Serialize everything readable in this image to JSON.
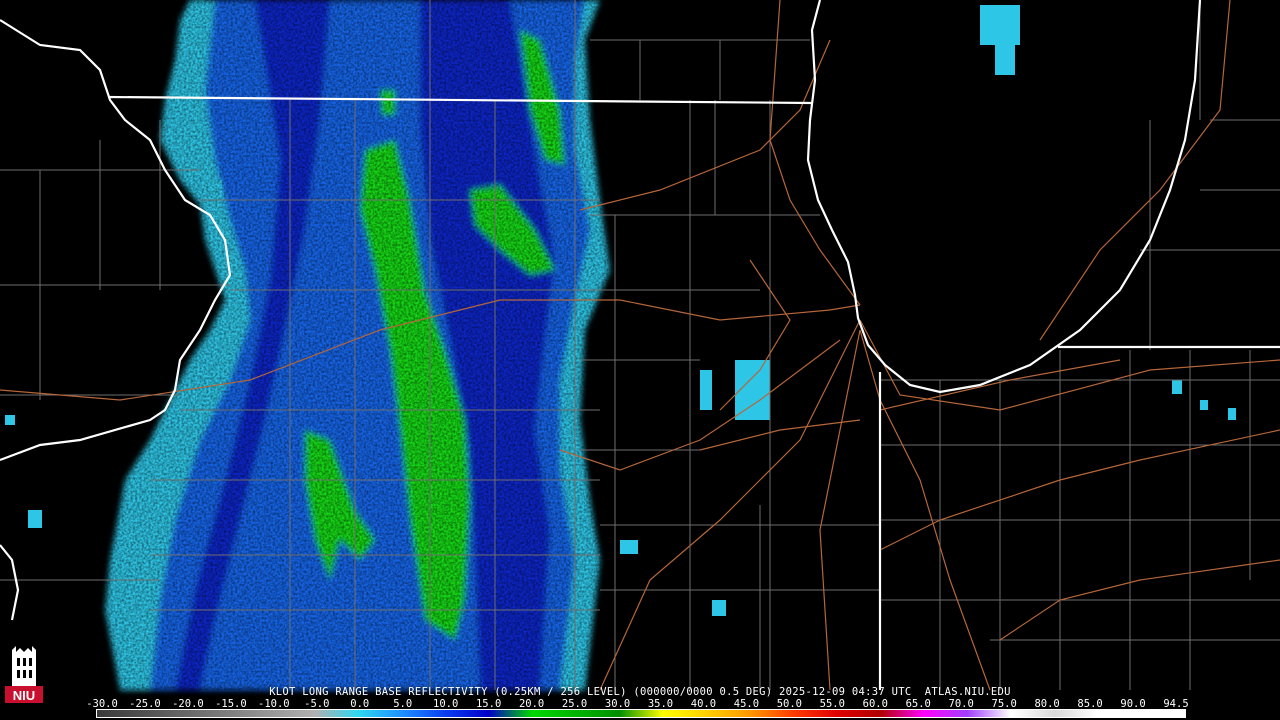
{
  "caption": "KLOT LONG RANGE BASE REFLECTIVITY (0.25KM / 256 LEVEL) (000000/0000 0.5 DEG) 2025-12-09 04:37 UTC  ATLAS.NIU.EDU",
  "scale": {
    "labels": [
      "-30.0",
      "-25.0",
      "-20.0",
      "-15.0",
      "-10.0",
      "-5.0",
      "0.0",
      "5.0",
      "10.0",
      "15.0",
      "20.0",
      "25.0",
      "30.0",
      "35.0",
      "40.0",
      "45.0",
      "50.0",
      "55.0",
      "60.0",
      "65.0",
      "70.0",
      "75.0",
      "80.0",
      "85.0",
      "90.0",
      "94.5"
    ],
    "colors": [
      "#3a3a3a",
      "#4f4f4f",
      "#666666",
      "#7e7e7e",
      "#979797",
      "#b0b0b0",
      "#2fd9f0",
      "#1e90ff",
      "#0a3df0",
      "#0000c8",
      "#00d800",
      "#00b400",
      "#008f00",
      "#ffff00",
      "#ffd000",
      "#ff9900",
      "#ff3c00",
      "#e00000",
      "#b00000",
      "#ff00ff",
      "#a040ff",
      "#ffffff",
      "#d8d8d8",
      "#ffffff",
      "#ffffff",
      "#ffffff"
    ]
  },
  "map": {
    "state_border_color": "#ffffff",
    "county_line_color": "#6e6e6e",
    "highway_color": "#b5663a",
    "lake_label": ""
  },
  "logo": {
    "text": "NIU",
    "color": "#c8102e"
  }
}
